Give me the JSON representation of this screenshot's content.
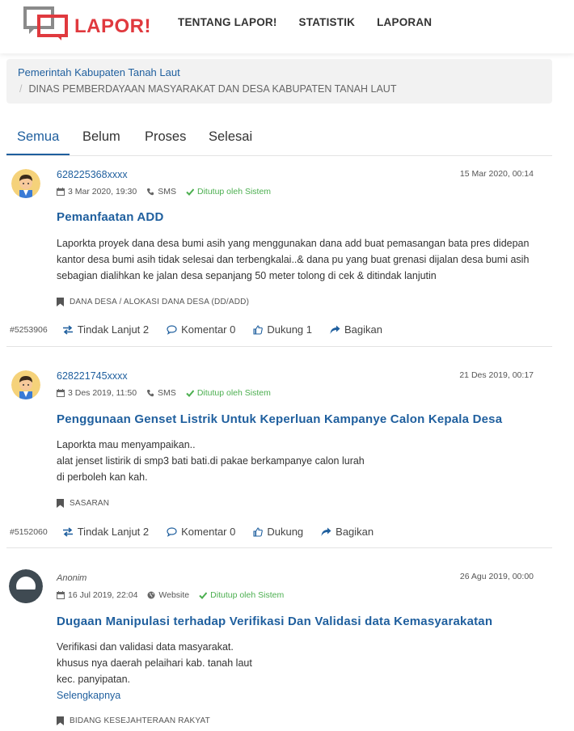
{
  "header": {
    "logo_text": "LAPOR!",
    "nav": [
      "TENTANG LAPOR!",
      "STATISTIK",
      "LAPORAN"
    ]
  },
  "breadcrumb": {
    "parent": "Pemerintah Kabupaten Tanah Laut",
    "current": "DINAS PEMBERDAYAAN MASYARAKAT DAN DESA KABUPATEN TANAH LAUT"
  },
  "tabs": [
    "Semua",
    "Belum",
    "Proses",
    "Selesai"
  ],
  "colors": {
    "accent": "#1f5f9e",
    "brand": "#e0393e",
    "status_closed": "#4caf50"
  },
  "reports": [
    {
      "user": "628225368xxxx",
      "date_submitted": "3 Mar 2020, 19:30",
      "channel": "SMS",
      "status": "Ditutup oleh Sistem",
      "date_updated": "15 Mar 2020, 00:14",
      "title": "Pemanfaatan ADD",
      "body": [
        "Laporkta proyek dana desa bumi asih yang menggunakan dana add buat pemasangan bata pres didepan kantor desa bumi asih tidak selesai dan terbengkalai..& dana pu yang buat grenasi dijalan desa bumi asih sebagian dialihkan ke jalan desa sepanjang 50 meter tolong di cek & ditindak lanjutin"
      ],
      "category": "DANA DESA / ALOKASI DANA DESA (DD/ADD)",
      "id": "#5253906",
      "followup": "Tindak Lanjut 2",
      "comment": "Komentar 0",
      "support": "Dukung 1",
      "share": "Bagikan"
    },
    {
      "user": "628221745xxxx",
      "date_submitted": "3 Des 2019, 11:50",
      "channel": "SMS",
      "status": "Ditutup oleh Sistem",
      "date_updated": "21 Des 2019, 00:17",
      "title": "Penggunaan Genset Listrik Untuk Keperluan Kampanye Calon Kepala Desa",
      "body": [
        "Laporkta mau menyampaikan..",
        "alat jenset listirik di smp3 bati bati.di pakae berkampanye calon lurah",
        "di perboleh kan kah."
      ],
      "category": "SASARAN",
      "id": "#5152060",
      "followup": "Tindak Lanjut 2",
      "comment": "Komentar 0",
      "support": "Dukung",
      "share": "Bagikan"
    },
    {
      "user": "Anonim",
      "date_submitted": "16 Jul 2019, 22:04",
      "channel": "Website",
      "status": "Ditutup oleh Sistem",
      "date_updated": "26 Agu 2019, 00:00",
      "title": "Dugaan Manipulasi terhadap Verifikasi Dan Validasi data Kemasyarakatan",
      "body": [
        "Verifikasi dan validasi data masyarakat.",
        "khusus nya daerah pelaihari kab. tanah laut",
        "kec. panyipatan."
      ],
      "more": "Selengkapnya",
      "category": "BIDANG KESEJAHTERAAN RAKYAT"
    }
  ]
}
